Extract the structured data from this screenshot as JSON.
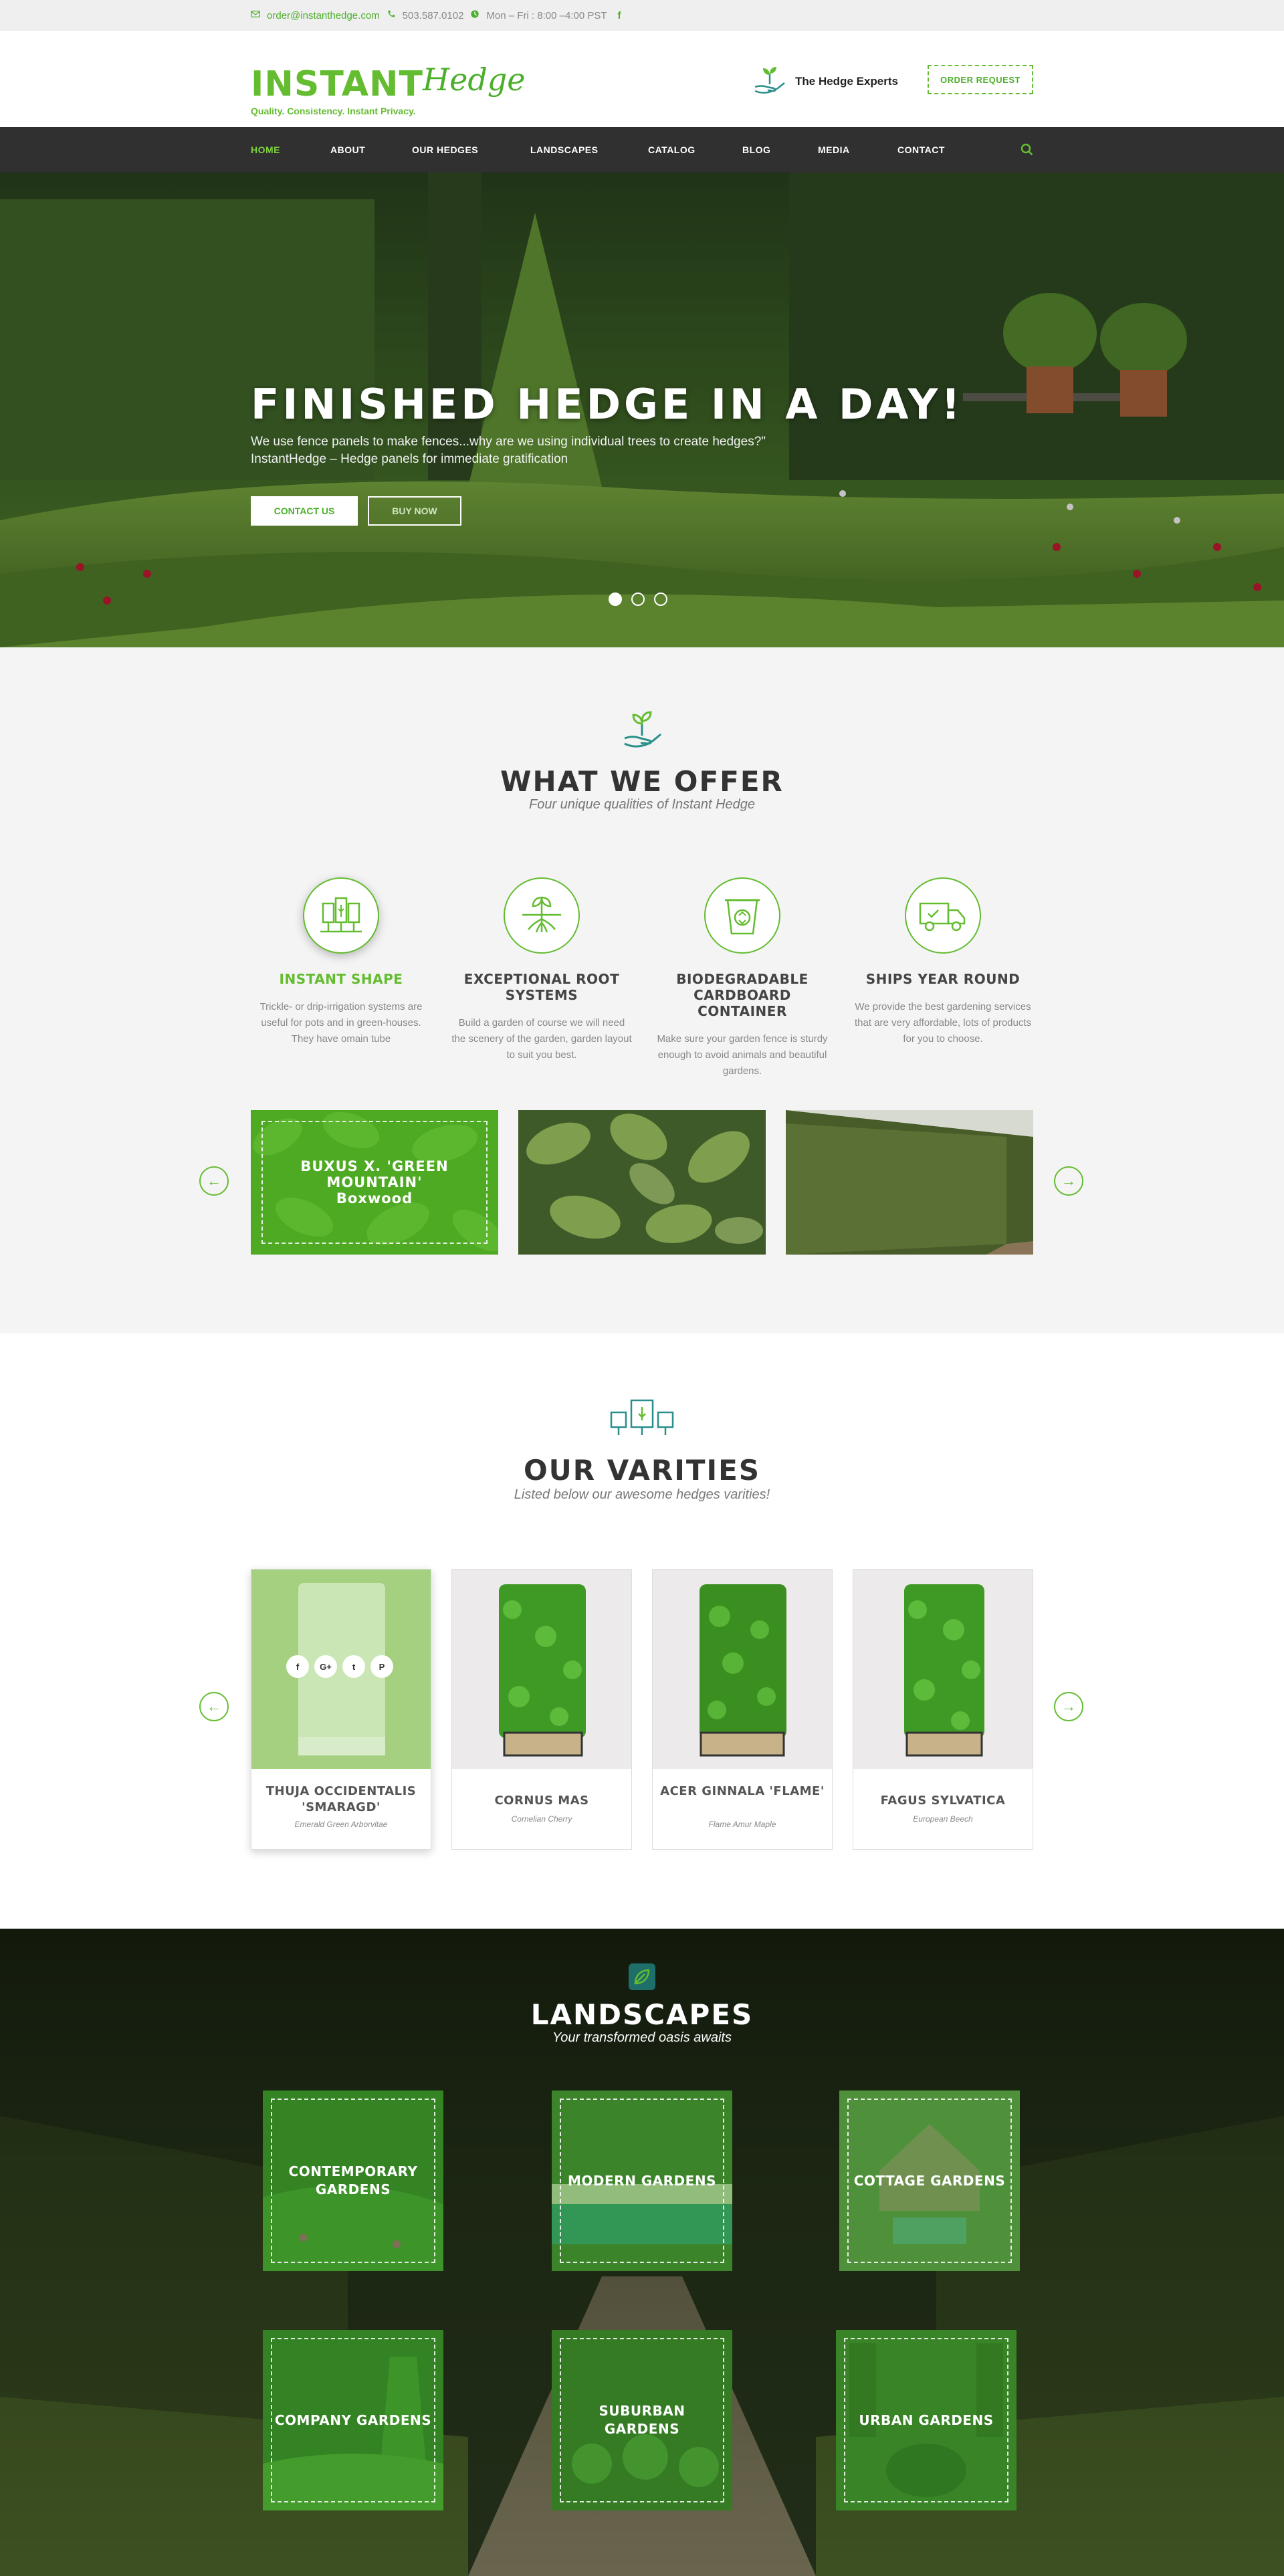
{
  "topbar": {
    "email": "order@instanthedge.com",
    "phone": "503.587.0102",
    "hours": "Mon – Fri : 8:00 –4:00 PST"
  },
  "header": {
    "brand_left": "INSTANT",
    "brand_right": "Hedge",
    "tagline": "Quality. Consistency. Instant Privacy.",
    "experts": "The Hedge Experts",
    "order_button": "ORDER REQUEST"
  },
  "nav": {
    "items": [
      "HOME",
      "ABOUT",
      "OUR HEDGES",
      "LANDSCAPES",
      "CATALOG",
      "BLOG",
      "MEDIA",
      "CONTACT"
    ]
  },
  "hero": {
    "title": "FINISHED HEDGE IN A DAY!",
    "text": "We use fence panels to make fences...why are we using individual trees to create hedges?\" InstantHedge – Hedge panels for immediate gratification",
    "btn_contact": "CONTACT US",
    "btn_buy": "BUY NOW"
  },
  "offer": {
    "title": "WHAT WE OFFER",
    "subtitle": "Four unique qualities of Instant Hedge",
    "features": [
      {
        "title": "INSTANT SHAPE",
        "text": "Trickle- or drip-irrigation systems are useful for pots and in green-houses. They have omain tube",
        "icon": "hedge-shape-icon"
      },
      {
        "title": "EXCEPTIONAL ROOT SYSTEMS",
        "text": "Build a garden of course we will need the scenery of the garden, garden layout to suit you best.",
        "icon": "roots-icon"
      },
      {
        "title": "BIODEGRADABLE CARDBOARD  CONTAINER",
        "text": "Make sure your garden fence is sturdy enough to avoid animals and beautiful gardens.",
        "icon": "recycle-container-icon"
      },
      {
        "title": "SHIPS YEAR ROUND",
        "text": "We provide the best gardening services that are very affordable, lots of products for you to choose.",
        "icon": "delivery-truck-icon"
      }
    ],
    "product_overlay": "BUXUS X. 'GREEN MOUNTAIN' Boxwood"
  },
  "varieties": {
    "title": "OUR VARITIES",
    "subtitle": "Listed below our awesome hedges varities!",
    "social": [
      "f",
      "G+",
      "t",
      "P"
    ],
    "items": [
      {
        "name": "THUJA OCCIDENTALIS 'SMARAGD'",
        "sub": "Emerald Green Arborvitae"
      },
      {
        "name": "CORNUS MAS",
        "sub": "Cornelian Cherry"
      },
      {
        "name": "ACER GINNALA 'FLAME'",
        "sub": "Flame Amur Maple"
      },
      {
        "name": "FAGUS SYLVATICA",
        "sub": "European Beech"
      }
    ]
  },
  "landscapes": {
    "title": "LANDSCAPES",
    "subtitle": "Your transformed oasis awaits",
    "tiles": [
      "CONTEMPORARY GARDENS",
      "MODERN GARDENS",
      "COTTAGE GARDENS",
      "COMPANY GARDENS",
      "SUBURBAN GARDENS",
      "URBAN GARDENS"
    ]
  },
  "colors": {
    "accent": "#64bc30",
    "nav_bg": "#303030",
    "section_bg": "#f4f4f4"
  }
}
